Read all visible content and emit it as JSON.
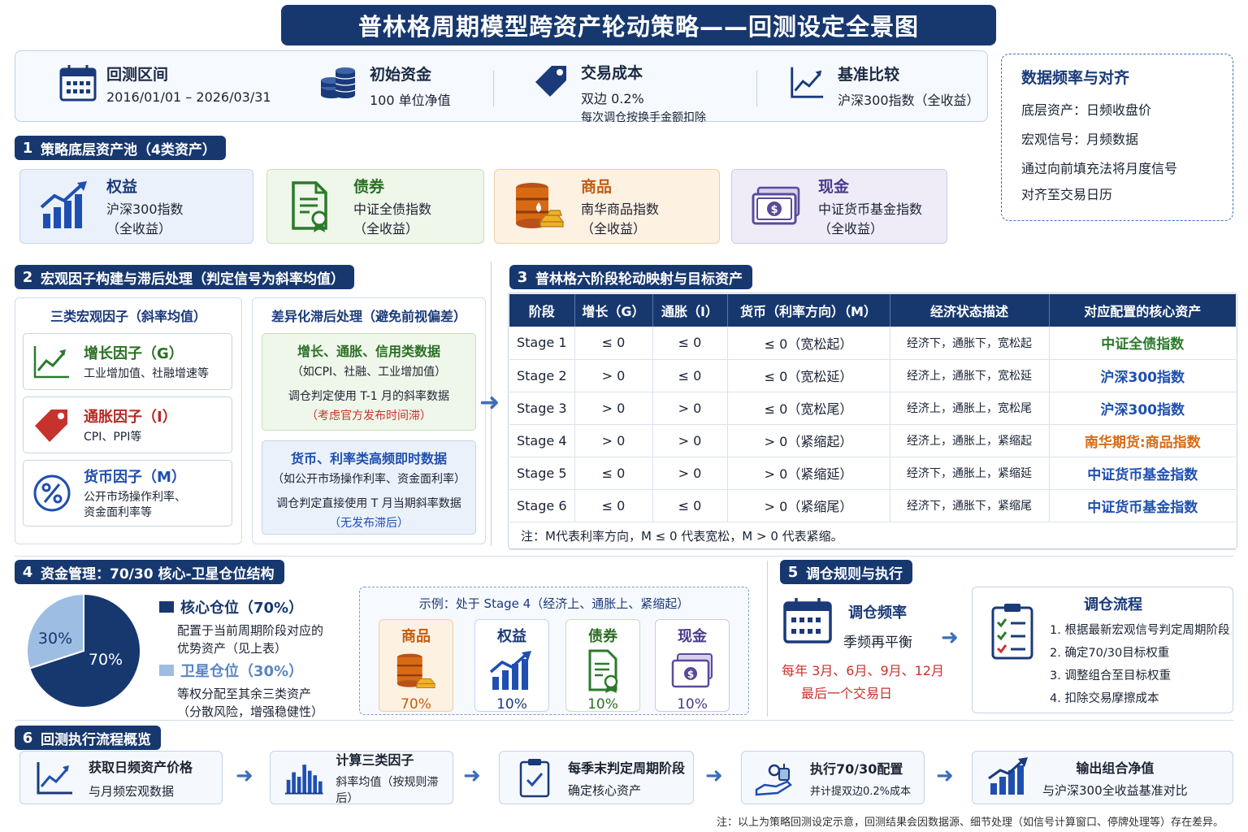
{
  "title": "普林格周期模型跨资产轮动策略——回测设定全景图",
  "top": {
    "period": {
      "label": "回测区间",
      "value": "2016/01/01 – 2026/03/31"
    },
    "capital": {
      "label": "初始资金",
      "value": "100 单位净值"
    },
    "cost": {
      "label": "交易成本",
      "value": "双边 0.2%",
      "sub": "每次调仓按换手金额扣除"
    },
    "bench": {
      "label": "基准比较",
      "value": "沪深300指数（全收益）"
    }
  },
  "data_freq": {
    "title": "数据频率与对齐",
    "lines": [
      "底层资产：日频收盘价",
      "宏观信号：月频数据",
      "通过向前填充法将月度信号",
      "对齐至交易日历"
    ]
  },
  "sec1": {
    "num": "1",
    "title": "策略底层资产池（4类资产）",
    "assets": [
      {
        "name": "权益",
        "l1": "沪深300指数",
        "l2": "（全收益）"
      },
      {
        "name": "债券",
        "l1": "中证全债指数",
        "l2": "（全收益）"
      },
      {
        "name": "商品",
        "l1": "南华商品指数",
        "l2": "（全收益）"
      },
      {
        "name": "现金",
        "l1": "中证货币基金指数",
        "l2": "（全收益）"
      }
    ]
  },
  "sec2": {
    "num": "2",
    "title": "宏观因子构建与滞后处理（判定信号为斜率均值）",
    "left_title": "三类宏观因子（斜率均值）",
    "factors": [
      {
        "name": "增长因子（G）",
        "d1": "工业增加值、社融增速等",
        "d2": ""
      },
      {
        "name": "通胀因子（I）",
        "d1": "CPI、PPI等",
        "d2": ""
      },
      {
        "name": "货币因子（M）",
        "d1": "公开市场操作利率、",
        "d2": "资金面利率等"
      }
    ],
    "right_title": "差异化滞后处理（避免前视偏差）",
    "lag1": {
      "h": "增长、通胀、信用类数据",
      "s": "（如CPI、社融、工业增加值）",
      "r": "调仓判定使用 T-1 月的斜率数据",
      "e": "（考虑官方发布时间滞）"
    },
    "lag2": {
      "h": "货币、利率类高频即时数据",
      "s": "（如公开市场操作利率、资金面利率）",
      "r": "调仓判定直接使用 T 月当期斜率数据",
      "e": "（无发布滞后）"
    }
  },
  "sec3": {
    "num": "3",
    "title": "普林格六阶段轮动映射与目标资产",
    "headers": [
      "阶段",
      "增长（G）",
      "通胀（I）",
      "货币（利率方向）（M）",
      "经济状态描述",
      "对应配置的核心资产"
    ],
    "rows": [
      [
        "Stage 1",
        "≤ 0",
        "≤ 0",
        "≤ 0（宽松起）",
        "经济下，通胀下，宽松起",
        "中证全债指数"
      ],
      [
        "Stage 2",
        "> 0",
        "≤ 0",
        "≤ 0（宽松延）",
        "经济上，通胀下，宽松延",
        "沪深300指数"
      ],
      [
        "Stage 3",
        "> 0",
        "> 0",
        "≤ 0（宽松尾）",
        "经济上，通胀上，宽松尾",
        "沪深300指数"
      ],
      [
        "Stage 4",
        "> 0",
        "> 0",
        "> 0（紧缩起）",
        "经济上，通胀上，紧缩起",
        "南华期货:商品指数"
      ],
      [
        "Stage 5",
        "≤ 0",
        "> 0",
        "> 0（紧缩延）",
        "经济下，通胀上，紧缩延",
        "中证货币基金指数"
      ],
      [
        "Stage 6",
        "≤ 0",
        "≤ 0",
        "> 0（紧缩尾）",
        "经济下，通胀下，紧缩尾",
        "中证货币基金指数"
      ]
    ],
    "asset_colors": [
      "#2b7a2b",
      "#1f4fb0",
      "#1f4fb0",
      "#d86a14",
      "#1f4fb0",
      "#1f4fb0"
    ],
    "note": "注：M代表利率方向，M ≤ 0 代表宽松，M > 0 代表紧缩。"
  },
  "sec4": {
    "num": "4",
    "title": "资金管理：70/30 核心-卫星仓位结构",
    "core": {
      "label": "核心仓位（70%）",
      "d1": "配置于当前周期阶段对应的",
      "d2": "优势资产（见上表）",
      "pct": "70%",
      "value": 70
    },
    "sat": {
      "label": "卫星仓位（30%）",
      "d1": "等权分配至其余三类资产",
      "d2": "（分散风险，增强稳健性）",
      "pct": "30%",
      "value": 30
    },
    "example_title": "示例：处于 Stage 4（经济上、通胀上、紧缩起）",
    "example": [
      {
        "name": "商品",
        "pct": "70%"
      },
      {
        "name": "权益",
        "pct": "10%"
      },
      {
        "name": "债券",
        "pct": "10%"
      },
      {
        "name": "现金",
        "pct": "10%"
      }
    ]
  },
  "sec5": {
    "num": "5",
    "title": "调仓规则与执行",
    "freq_label": "调仓频率",
    "freq_val": "季频再平衡",
    "freq_r1": "每年 3月、6月、9月、12月",
    "freq_r2": "最后一个交易日",
    "flow_title": "调仓流程",
    "steps": [
      "1. 根据最新宏观信号判定周期阶段",
      "2. 确定70/30目标权重",
      "3. 调整组合至目标权重",
      "4. 扣除交易摩擦成本"
    ]
  },
  "sec6": {
    "num": "6",
    "title": "回测执行流程概览",
    "steps": [
      {
        "a": "获取日频资产价格",
        "b": "与月频宏观数据"
      },
      {
        "a": "计算三类因子",
        "b": "斜率均值（按规则滞后）"
      },
      {
        "a": "每季末判定周期阶段",
        "b": "确定核心资产"
      },
      {
        "a": "执行70/30配置",
        "b": "并计提双边0.2%成本"
      },
      {
        "a": "输出组合净值",
        "b": "与沪深300全收益基准对比"
      }
    ]
  },
  "footer": "注：以上为策略回测设定示意，回测结果会因数据源、细节处理（如信号计算窗口、停牌处理等）存在差异。"
}
